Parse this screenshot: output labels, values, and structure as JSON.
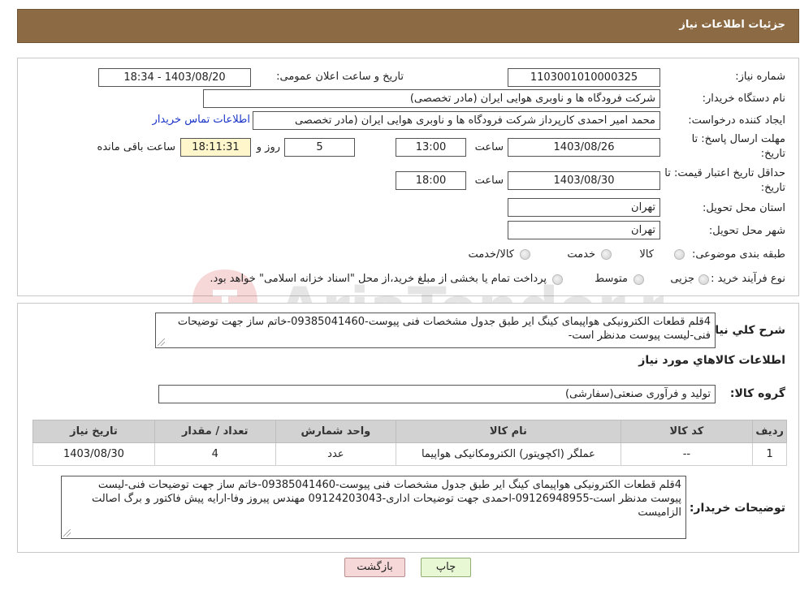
{
  "header": {
    "title": "جزئیات اطلاعات نیاز"
  },
  "form": {
    "need_number": {
      "label": "شماره نیاز:",
      "value": "1103001010000325"
    },
    "announce_datetime": {
      "label": "تاریخ و ساعت اعلان عمومی:",
      "value": "1403/08/20 - 18:34"
    },
    "buyer_org": {
      "label": "نام دستگاه خریدار:",
      "value": "شرکت فرودگاه ها و ناوبری هوایی ایران (مادر تخصصی)"
    },
    "requester": {
      "label": "ایجاد کننده درخواست:",
      "value": "محمد امیر احمدی کارپرداز شرکت فرودگاه ها و ناوبری هوایی ایران (مادر تخصصی",
      "contact_link": "اطلاعات تماس خریدار"
    },
    "deadline": {
      "label_line1": "مهلت ارسال پاسخ: تا",
      "label_line2": "تاریخ:",
      "date": "1403/08/26",
      "time_label": "ساعت",
      "time": "13:00",
      "days": "5",
      "days_label": "روز و",
      "remaining": "18:11:31",
      "remaining_label": "ساعت باقی مانده"
    },
    "price_validity": {
      "label_line1": "حداقل تاریخ اعتبار قیمت: تا",
      "label_line2": "تاریخ:",
      "date": "1403/08/30",
      "time_label": "ساعت",
      "time": "18:00"
    },
    "province": {
      "label": "استان محل تحویل:",
      "value": "تهران"
    },
    "city": {
      "label": "شهر محل تحویل:",
      "value": "تهران"
    },
    "category": {
      "label": "طبقه بندی موضوعی:",
      "options": [
        "کالا",
        "خدمت",
        "کالا/خدمت"
      ]
    },
    "purchase_type": {
      "label": "نوع فرآیند خرید :",
      "options": [
        "جزیی",
        "متوسط"
      ],
      "note": "پرداخت تمام یا بخشی از مبلغ خرید،از محل \"اسناد خزانه اسلامی\" خواهد بود."
    }
  },
  "watermark": {
    "text": "AriaTender.neT"
  },
  "summary": {
    "label": "شرح کلي نياز:",
    "value": "4قلم قطعات الکترونیکی هواپیمای کینگ ایر طبق جدول مشخصات فنی پیوست-09385041460-خاتم ساز جهت توضیحات فنی-لیست پیوست مدنظر است-"
  },
  "goods": {
    "title": "اطلاعات کالاهاي مورد نياز",
    "group_label": "گروه کالا:",
    "group_value": "تولید و فرآوری صنعتی(سفارشی)",
    "columns": [
      "رديف",
      "کد کالا",
      "نام کالا",
      "واحد شمارش",
      "تعداد / مقدار",
      "تاريخ نياز"
    ],
    "rows": [
      [
        "1",
        "--",
        "عملگر (اکچویتور) الکترومکانیکی هواپیما",
        "عدد",
        "4",
        "1403/08/30"
      ]
    ]
  },
  "buyer_notes": {
    "label": "توضيحات خريدار:",
    "value": "4قلم قطعات الکترونیکی هواپیمای کینگ ایر طبق جدول مشخصات فنی پیوست-09385041460-خاتم ساز جهت توضیحات فنی-لیست پیوست مدنظر است-09126948955-احمدی جهت توضیحات اداری-09124203043 مهندس پیروز وفا-ارایه پیش فاکتور و برگ اصالت الزامیست"
  },
  "buttons": {
    "back": "بازگشت",
    "print": "چاپ"
  },
  "colors": {
    "header": "#8b6a44",
    "table_header": "#d2d2d2",
    "link": "#1a35c8"
  }
}
